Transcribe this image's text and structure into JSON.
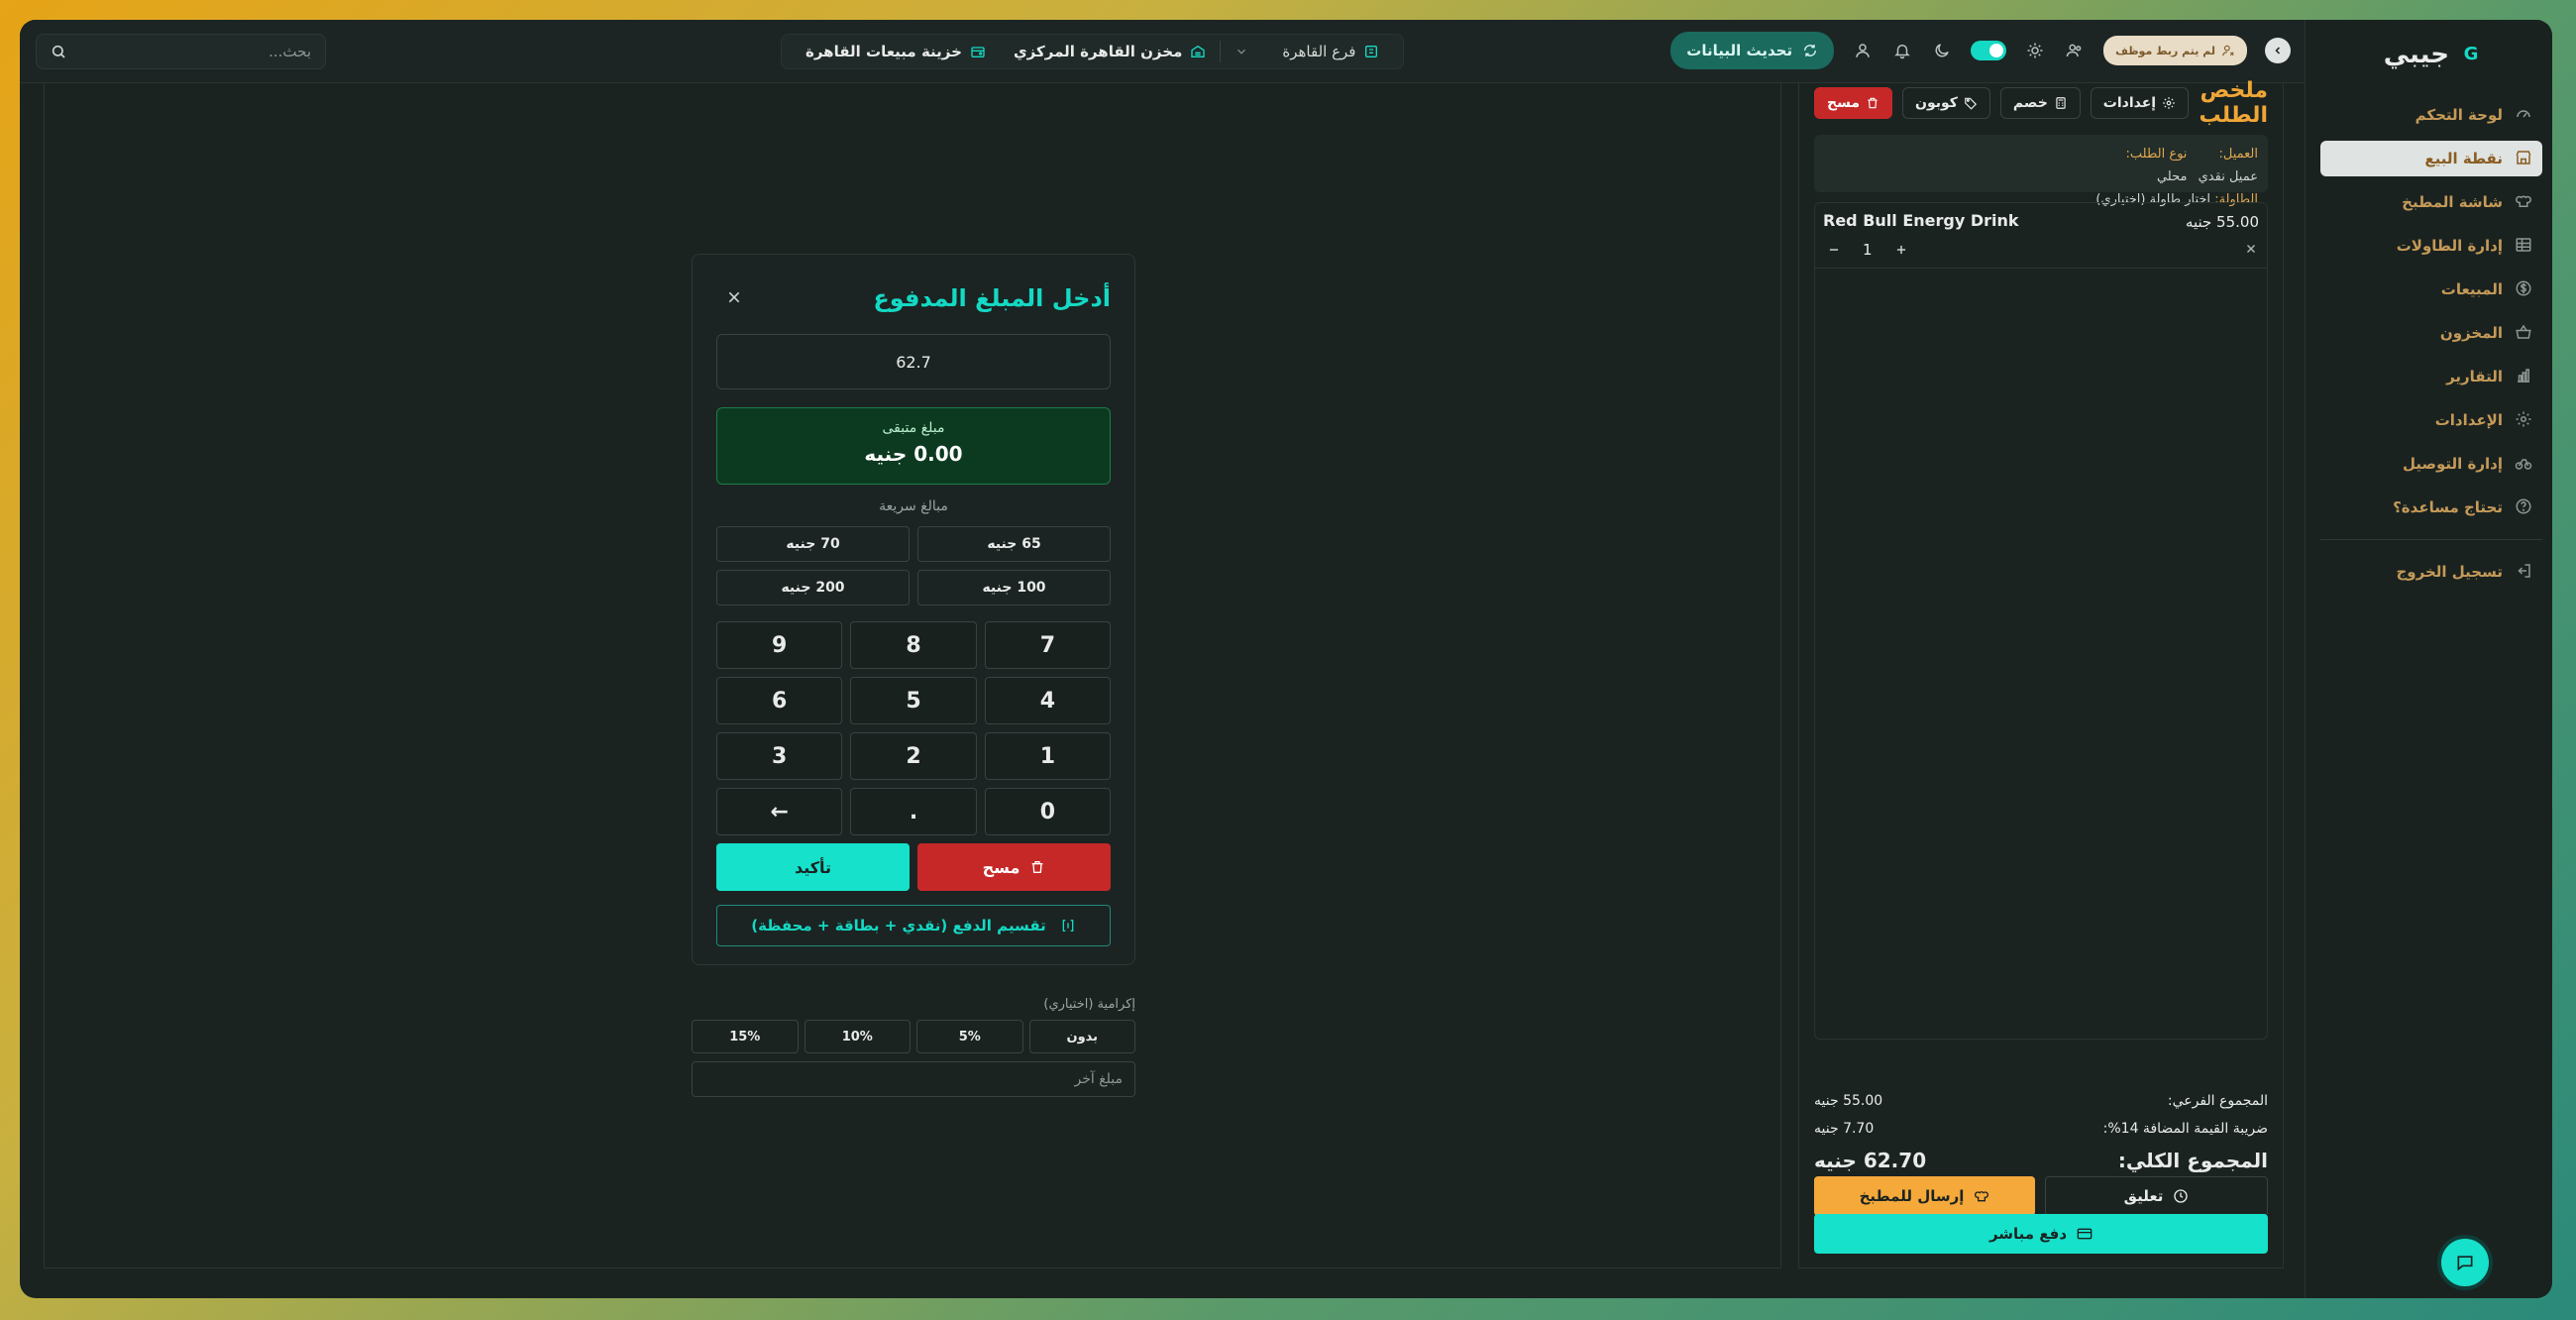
{
  "app": {
    "brand": "جيبي",
    "brand_mark": "G"
  },
  "topbar": {
    "search_placeholder": "بحث...",
    "treasury": "خزينة مبيعات القاهرة",
    "warehouse": "مخزن القاهرة المركزي",
    "branch": "فرع القاهرة",
    "refresh_label": "تحديث البيانات",
    "employee_badge": "لم يتم ربط موظف"
  },
  "sidebar": {
    "items": [
      {
        "label": "لوحة التحكم",
        "icon": "gauge-icon",
        "active": false
      },
      {
        "label": "نقطة البيع",
        "icon": "store-icon",
        "active": true
      },
      {
        "label": "شاشة المطبخ",
        "icon": "chef-hat-icon",
        "active": false
      },
      {
        "label": "إدارة الطاولات",
        "icon": "table-grid-icon",
        "active": false
      },
      {
        "label": "المبيعات",
        "icon": "dollar-circle-icon",
        "active": false
      },
      {
        "label": "المخزون",
        "icon": "basket-icon",
        "active": false
      },
      {
        "label": "التقارير",
        "icon": "chart-icon",
        "active": false
      },
      {
        "label": "الإعدادات",
        "icon": "gear-icon",
        "active": false
      },
      {
        "label": "إدارة التوصيل",
        "icon": "bike-icon",
        "active": false
      },
      {
        "label": "تحتاج مساعدة؟",
        "icon": "help-icon",
        "active": false
      }
    ],
    "logout": "تسجيل الخروج"
  },
  "order": {
    "title": "ملخص الطلب",
    "settings": "إعدادات",
    "discount": "خصم",
    "coupon": "كوبون",
    "clear": "مسح",
    "customer_label": "العميل:",
    "customer_value": "عميل نقدي",
    "order_type_label": "نوع الطلب:",
    "order_type_value": "محلي",
    "table_label": "الطاولة:",
    "table_value": "اختار طاولة (اختياري)",
    "items": [
      {
        "name": "Red Bull Energy Drink",
        "price": "55.00 جنيه",
        "qty": "1"
      }
    ],
    "subtotal_label": "المجموع الفرعي:",
    "subtotal_value": "55.00 جنيه",
    "vat_label": "ضريبة القيمة المضافة 14%:",
    "vat_value": "7.70 جنيه",
    "total_label": "المجموع الكلي:",
    "total_value": "62.70 جنيه",
    "hold": "تعليق",
    "send_kitchen": "إرسال للمطبخ",
    "pay_now": "دفع مباشر"
  },
  "modal": {
    "title": "أدخل المبلغ المدفوع",
    "amount": "62.7",
    "change_label": "مبلغ متبقى",
    "change_value": "0.00 جنيه",
    "quick_label": "مبالغ سريعة",
    "quick": [
      "65 جنيه",
      "70 جنيه",
      "100 جنيه",
      "200 جنيه"
    ],
    "keys": [
      "7",
      "8",
      "9",
      "4",
      "5",
      "6",
      "1",
      "2",
      "3",
      "0",
      ".",
      "←"
    ],
    "clear": "مسح",
    "confirm": "تأكيد",
    "split": "تقسيم الدفع (نقدي + بطاقة + محفظة)"
  },
  "tip": {
    "label": "إكرامية (اختياري)",
    "options": [
      "بدون",
      "5%",
      "10%",
      "15%"
    ],
    "other_placeholder": "مبلغ آخر"
  },
  "colors": {
    "accent": "#14d9c4",
    "orange": "#f0a637",
    "danger": "#c62828",
    "bg": "#1b2321"
  }
}
